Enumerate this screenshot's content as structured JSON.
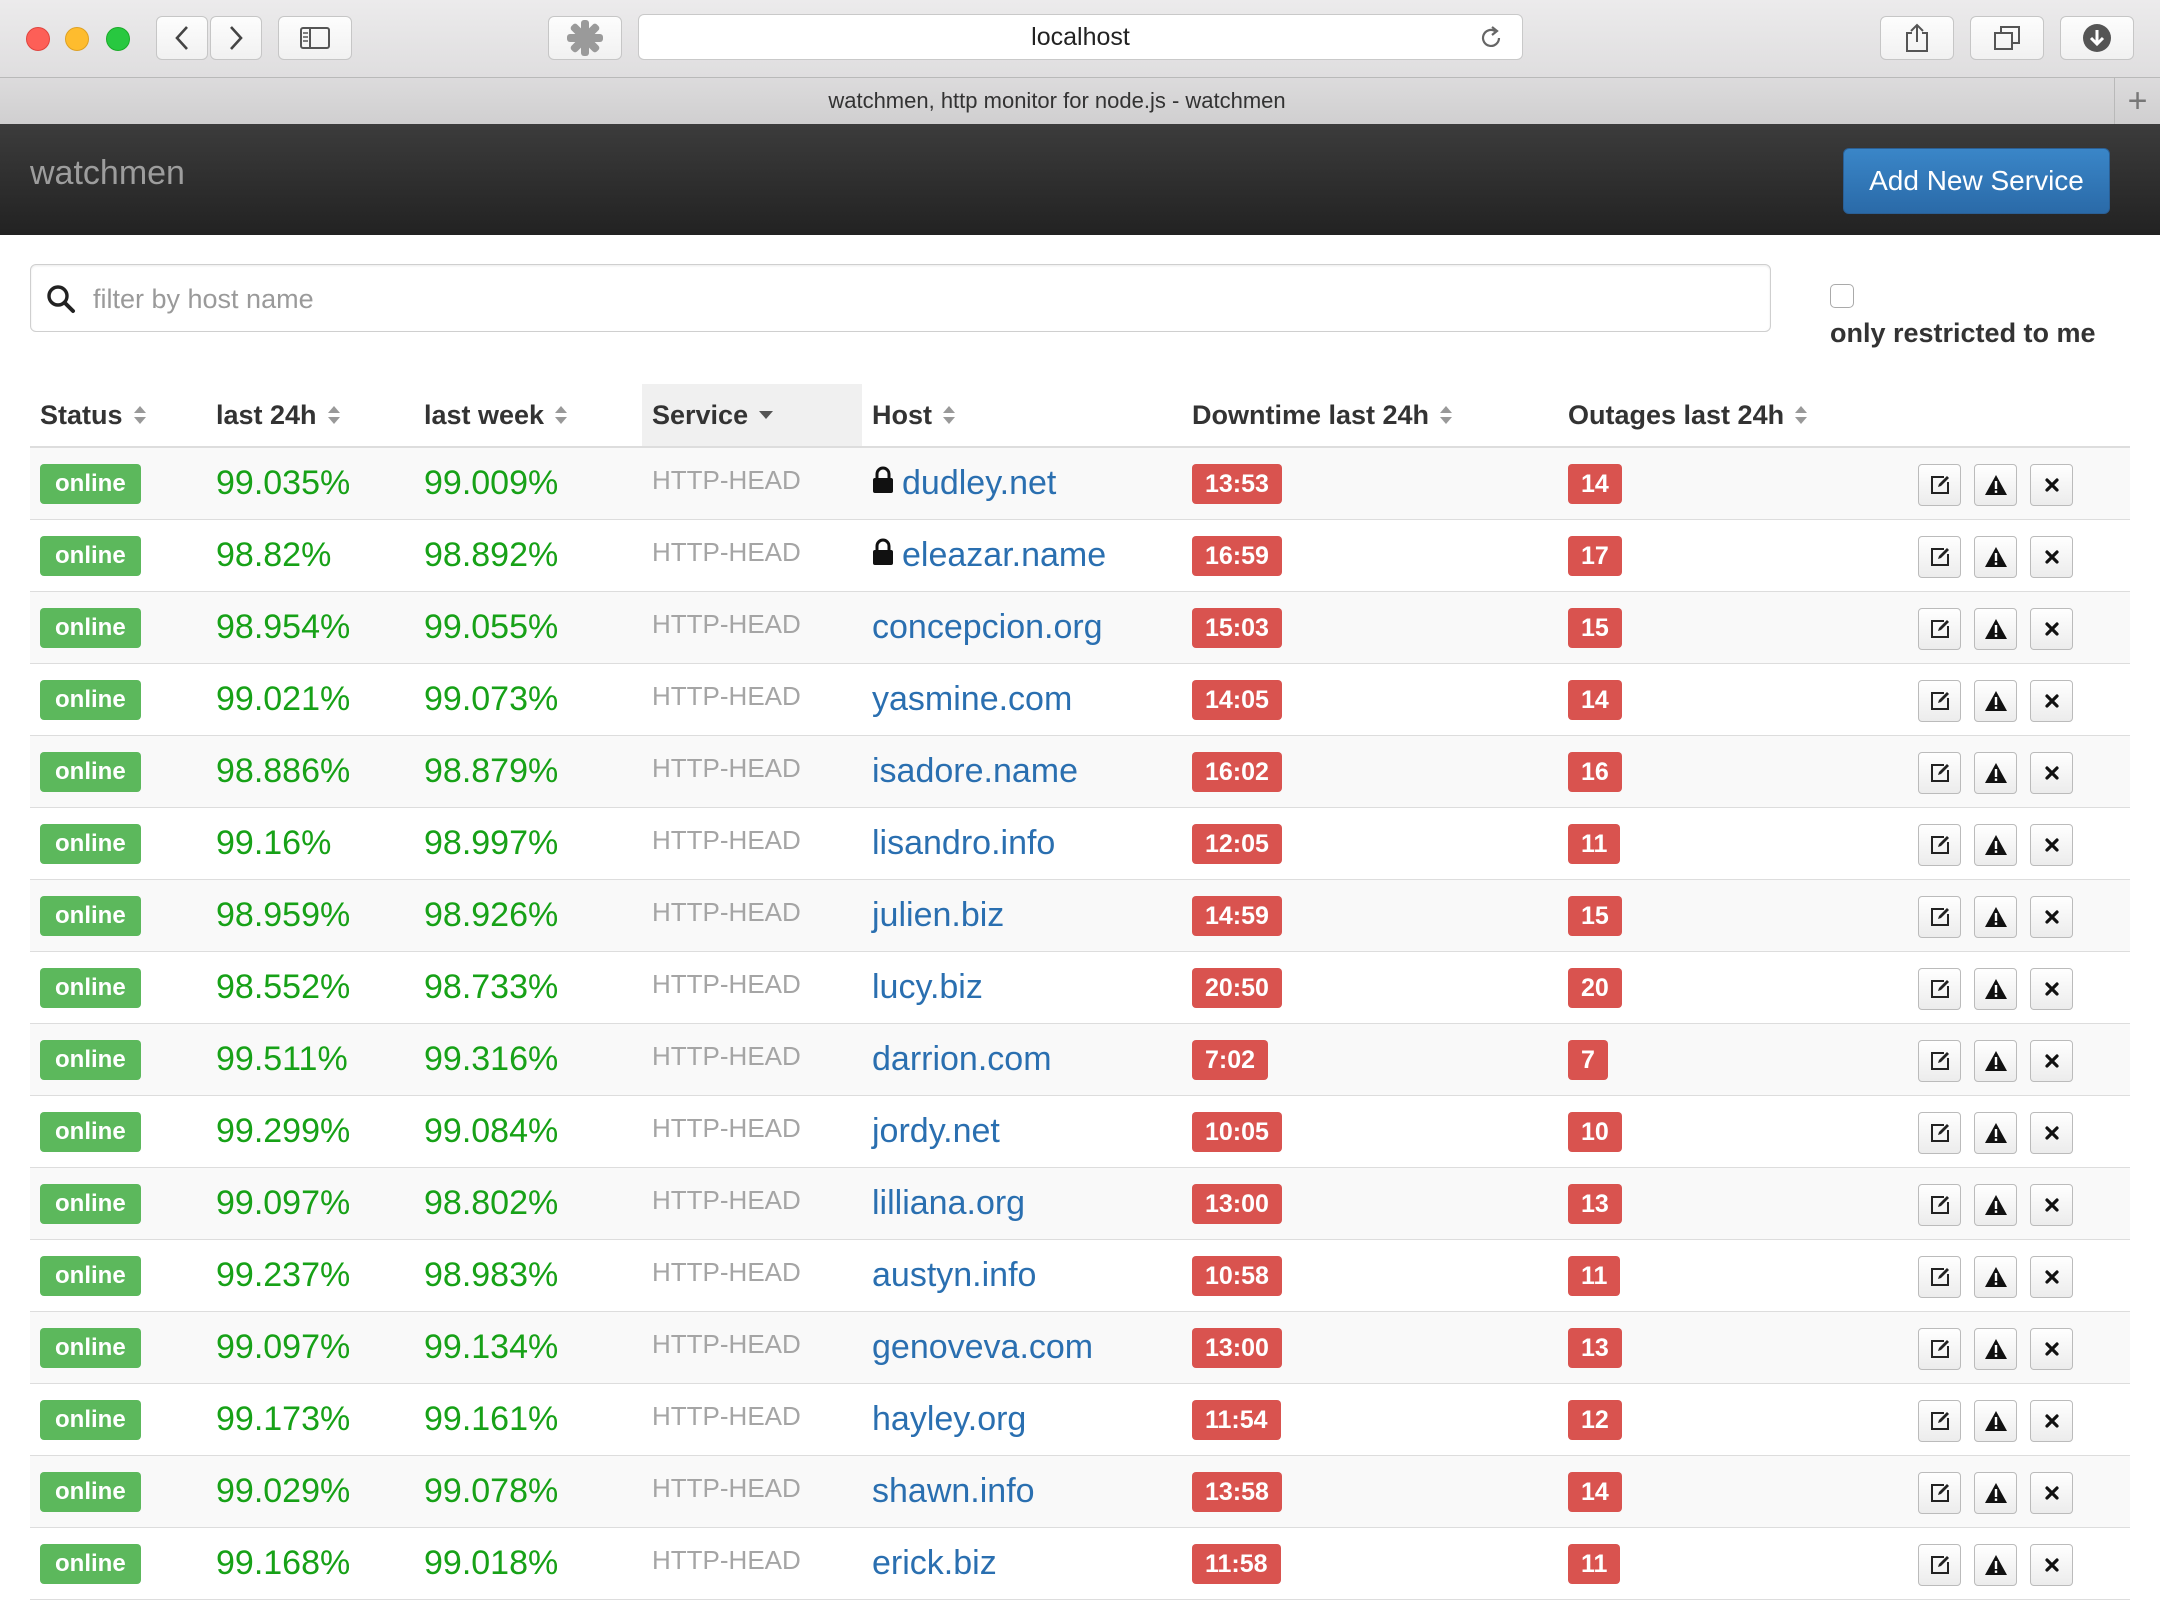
{
  "browser": {
    "address": "localhost",
    "tab_title": "watchmen, http monitor for node.js - watchmen"
  },
  "app": {
    "brand": "watchmen",
    "add_button": "Add New Service"
  },
  "filter": {
    "placeholder": "filter by host name",
    "value": "",
    "restricted_label": "only restricted to me",
    "restricted_checked": false
  },
  "table": {
    "headers": [
      "Status",
      "last 24h",
      "last week",
      "Service",
      "Host",
      "Downtime last 24h",
      "Outages last 24h"
    ],
    "sorted_column": "Service",
    "rows": [
      {
        "status": "online",
        "last24h": "99.035%",
        "lastweek": "99.009%",
        "service": "HTTP-HEAD",
        "host": "dudley.net",
        "restricted": true,
        "downtime": "13:53",
        "outages": "14"
      },
      {
        "status": "online",
        "last24h": "98.82%",
        "lastweek": "98.892%",
        "service": "HTTP-HEAD",
        "host": "eleazar.name",
        "restricted": true,
        "downtime": "16:59",
        "outages": "17"
      },
      {
        "status": "online",
        "last24h": "98.954%",
        "lastweek": "99.055%",
        "service": "HTTP-HEAD",
        "host": "concepcion.org",
        "restricted": false,
        "downtime": "15:03",
        "outages": "15"
      },
      {
        "status": "online",
        "last24h": "99.021%",
        "lastweek": "99.073%",
        "service": "HTTP-HEAD",
        "host": "yasmine.com",
        "restricted": false,
        "downtime": "14:05",
        "outages": "14"
      },
      {
        "status": "online",
        "last24h": "98.886%",
        "lastweek": "98.879%",
        "service": "HTTP-HEAD",
        "host": "isadore.name",
        "restricted": false,
        "downtime": "16:02",
        "outages": "16"
      },
      {
        "status": "online",
        "last24h": "99.16%",
        "lastweek": "98.997%",
        "service": "HTTP-HEAD",
        "host": "lisandro.info",
        "restricted": false,
        "downtime": "12:05",
        "outages": "11"
      },
      {
        "status": "online",
        "last24h": "98.959%",
        "lastweek": "98.926%",
        "service": "HTTP-HEAD",
        "host": "julien.biz",
        "restricted": false,
        "downtime": "14:59",
        "outages": "15"
      },
      {
        "status": "online",
        "last24h": "98.552%",
        "lastweek": "98.733%",
        "service": "HTTP-HEAD",
        "host": "lucy.biz",
        "restricted": false,
        "downtime": "20:50",
        "outages": "20"
      },
      {
        "status": "online",
        "last24h": "99.511%",
        "lastweek": "99.316%",
        "service": "HTTP-HEAD",
        "host": "darrion.com",
        "restricted": false,
        "downtime": "7:02",
        "outages": "7"
      },
      {
        "status": "online",
        "last24h": "99.299%",
        "lastweek": "99.084%",
        "service": "HTTP-HEAD",
        "host": "jordy.net",
        "restricted": false,
        "downtime": "10:05",
        "outages": "10"
      },
      {
        "status": "online",
        "last24h": "99.097%",
        "lastweek": "98.802%",
        "service": "HTTP-HEAD",
        "host": "lilliana.org",
        "restricted": false,
        "downtime": "13:00",
        "outages": "13"
      },
      {
        "status": "online",
        "last24h": "99.237%",
        "lastweek": "98.983%",
        "service": "HTTP-HEAD",
        "host": "austyn.info",
        "restricted": false,
        "downtime": "10:58",
        "outages": "11"
      },
      {
        "status": "online",
        "last24h": "99.097%",
        "lastweek": "99.134%",
        "service": "HTTP-HEAD",
        "host": "genoveva.com",
        "restricted": false,
        "downtime": "13:00",
        "outages": "13"
      },
      {
        "status": "online",
        "last24h": "99.173%",
        "lastweek": "99.161%",
        "service": "HTTP-HEAD",
        "host": "hayley.org",
        "restricted": false,
        "downtime": "11:54",
        "outages": "12"
      },
      {
        "status": "online",
        "last24h": "99.029%",
        "lastweek": "99.078%",
        "service": "HTTP-HEAD",
        "host": "shawn.info",
        "restricted": false,
        "downtime": "13:58",
        "outages": "14"
      },
      {
        "status": "online",
        "last24h": "99.168%",
        "lastweek": "99.018%",
        "service": "HTTP-HEAD",
        "host": "erick.biz",
        "restricted": false,
        "downtime": "11:58",
        "outages": "11"
      }
    ],
    "row_actions": [
      "edit-icon",
      "warning-icon",
      "delete-icon"
    ]
  },
  "colors": {
    "status_online": "#5cb85c",
    "uptime_green": "#17a117",
    "danger_red": "#d9534f",
    "link_blue": "#2a6fb0",
    "primary_button": "#2a6aa8",
    "navbar": "#222222"
  }
}
